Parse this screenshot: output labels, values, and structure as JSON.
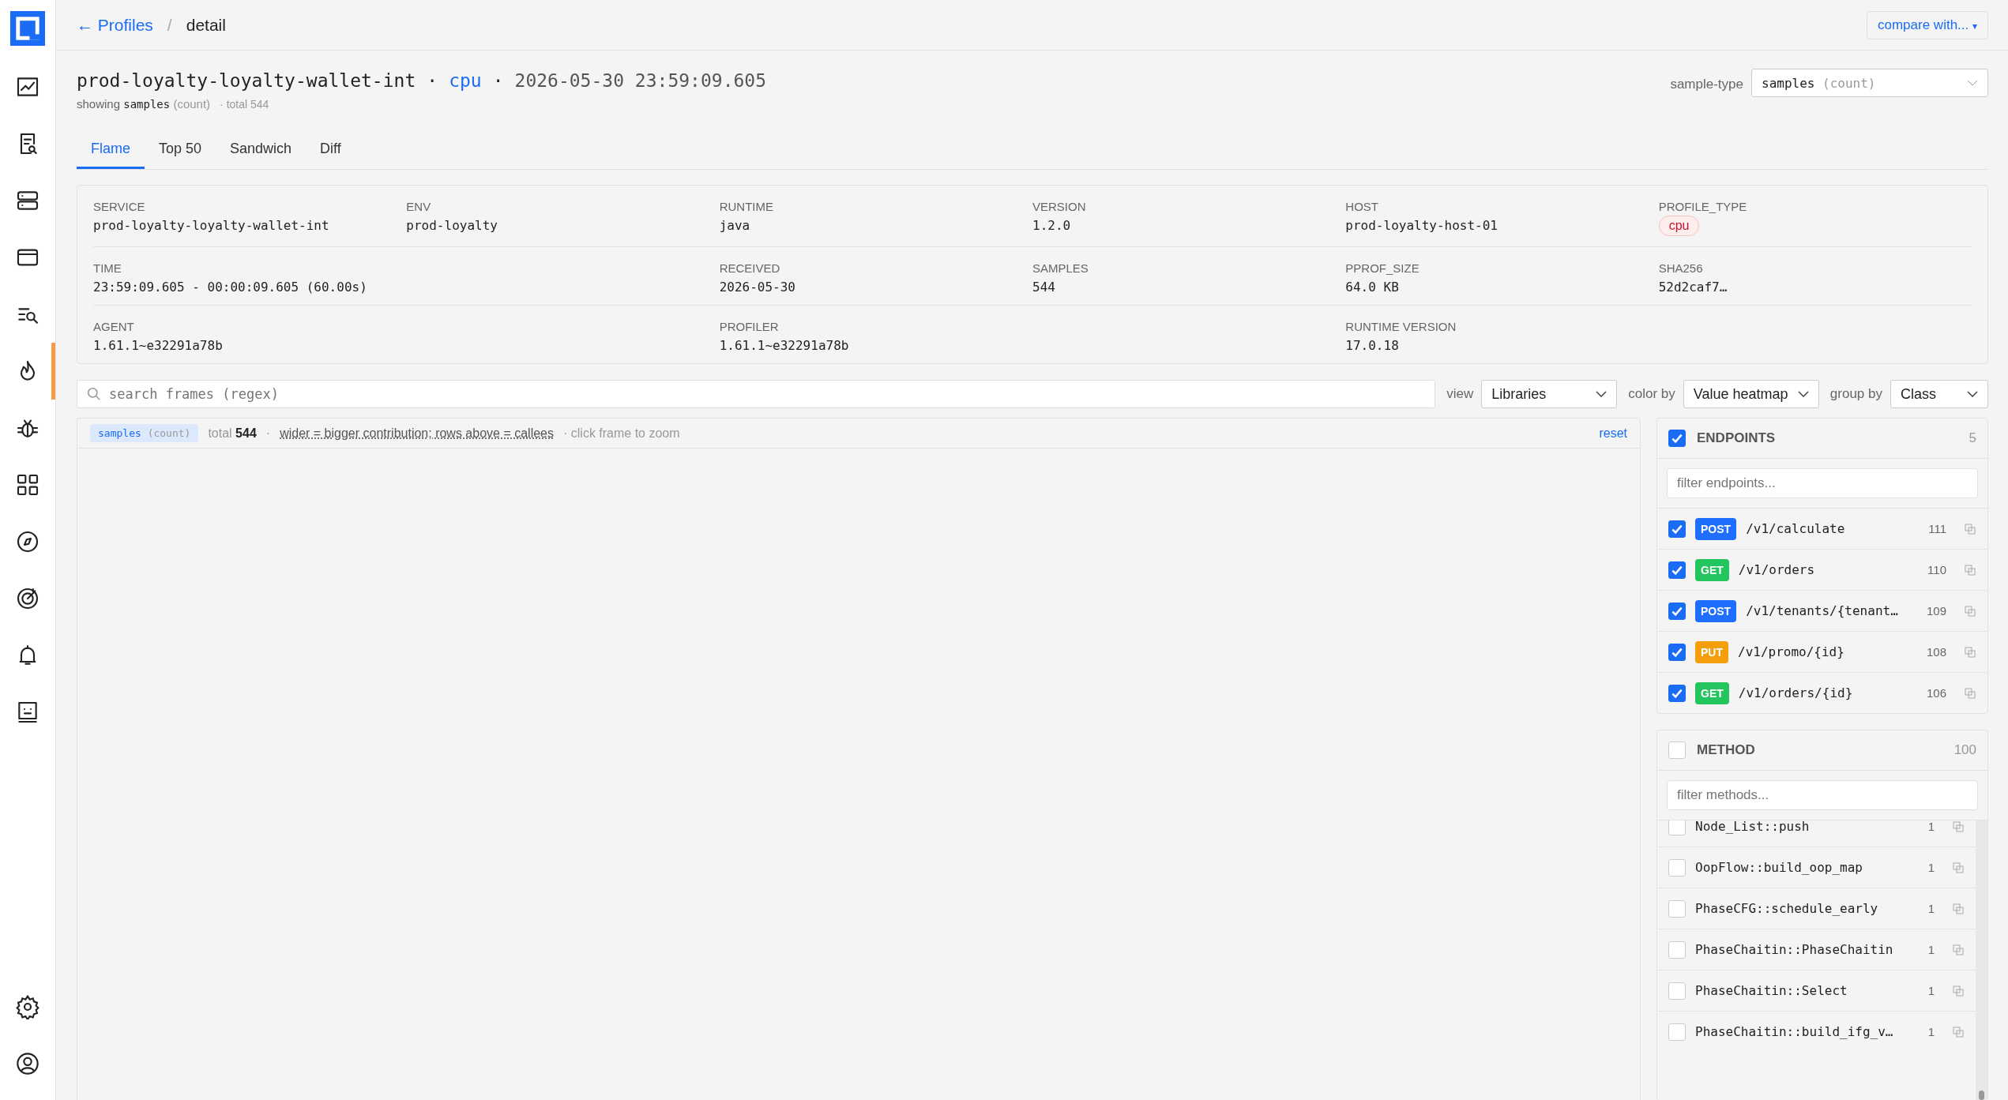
{
  "sidebar": {
    "items": [
      {
        "selected": false
      },
      {
        "selected": false
      },
      {
        "selected": false
      },
      {
        "selected": false
      },
      {
        "selected": false
      },
      {
        "selected": true
      },
      {
        "selected": false
      },
      {
        "selected": false
      },
      {
        "selected": false
      },
      {
        "selected": false
      },
      {
        "selected": false
      },
      {
        "selected": false
      }
    ],
    "bottom_items": [
      {
        "selected": false
      },
      {
        "selected": false
      }
    ]
  },
  "breadcrumb": {
    "back": "← Profiles",
    "separator": "/",
    "current": "detail"
  },
  "compare_button": {
    "label": "compare with...",
    "caret": "▾"
  },
  "title": {
    "service": "prod-loyalty-loyalty-wallet-int",
    "sep1": "·",
    "type": "cpu",
    "sep2": "·",
    "timestamp": "2026-05-30 23:59:09.605"
  },
  "subtitle": {
    "prefix": "showing",
    "metric": "samples",
    "unit": "(count)",
    "total": "· total 544"
  },
  "sample_type": {
    "label": "sample-type",
    "value": "samples",
    "unit": "(count)"
  },
  "tabs": [
    {
      "label": "Flame",
      "selected": true
    },
    {
      "label": "Top 50",
      "selected": false
    },
    {
      "label": "Sandwich",
      "selected": false
    },
    {
      "label": "Diff",
      "selected": false
    }
  ],
  "metadata": [
    [
      {
        "label": "SERVICE",
        "value": "prod-loyalty-loyalty-wallet-int",
        "kind": "text"
      },
      {
        "label": "ENV",
        "value": "prod-loyalty",
        "kind": "text"
      },
      {
        "label": "RUNTIME",
        "value": "java",
        "kind": "text"
      },
      {
        "label": "VERSION",
        "value": "1.2.0",
        "kind": "text"
      },
      {
        "label": "HOST",
        "value": "prod-loyalty-host-01",
        "kind": "text"
      },
      {
        "label": "PROFILE_TYPE",
        "value": "cpu",
        "kind": "badge"
      }
    ],
    [
      {
        "label": "TIME",
        "value": "23:59:09.605 - 00:00:09.605 (60.00s)",
        "kind": "text"
      },
      {
        "label": "RECEIVED",
        "value": "2026-05-30",
        "kind": "text"
      },
      {
        "label": "SAMPLES",
        "value": "544",
        "kind": "text"
      },
      {
        "label": "PPROF_SIZE",
        "value": "64.0 KB",
        "kind": "text"
      },
      {
        "label": "SHA256",
        "value": "52d2caf7…",
        "kind": "text"
      }
    ],
    [
      {
        "label": "AGENT",
        "value": "1.61.1~e32291a78b",
        "kind": "text"
      },
      {
        "label": "PROFILER",
        "value": "1.61.1~e32291a78b",
        "kind": "text"
      },
      {
        "label": "RUNTIME VERSION",
        "value": "17.0.18",
        "kind": "text"
      }
    ]
  ],
  "search": {
    "placeholder": "search frames (regex)"
  },
  "view": {
    "label": "view",
    "value": "Libraries"
  },
  "color_by": {
    "label": "color by",
    "value": "Value heatmap"
  },
  "group_by": {
    "label": "group by",
    "value": "Class"
  },
  "flame": {
    "metric": "samples",
    "unit": "(count)",
    "total_label": "total",
    "total": "544",
    "dot": "·",
    "hint": "wider = bigger contribution; rows above = callees",
    "click_hint": "· click frame to zoom",
    "reset": "reset"
  },
  "endpoints": {
    "title": "ENDPOINTS",
    "checked": true,
    "count": "5",
    "placeholder": "filter endpoints...",
    "items": [
      {
        "checked": true,
        "method": "POST",
        "color": "#1f6fff",
        "path": "/v1/calculate",
        "count": "111"
      },
      {
        "checked": true,
        "method": "GET",
        "color": "#22c55e",
        "path": "/v1/orders",
        "count": "110"
      },
      {
        "checked": true,
        "method": "POST",
        "color": "#1f6fff",
        "path": "/v1/tenants/{tenant…",
        "count": "109"
      },
      {
        "checked": true,
        "method": "PUT",
        "color": "#f59e0b",
        "path": "/v1/promo/{id}",
        "count": "108"
      },
      {
        "checked": true,
        "method": "GET",
        "color": "#22c55e",
        "path": "/v1/orders/{id}",
        "count": "106"
      }
    ]
  },
  "methods": {
    "title": "METHOD",
    "checked": false,
    "count": "100",
    "placeholder": "filter methods...",
    "items": [
      {
        "checked": false,
        "name": "Node_List::push",
        "count": "1"
      },
      {
        "checked": false,
        "name": "OopFlow::build_oop_map",
        "count": "1"
      },
      {
        "checked": false,
        "name": "PhaseCFG::schedule_early",
        "count": "1"
      },
      {
        "checked": false,
        "name": "PhaseChaitin::PhaseChaitin",
        "count": "1"
      },
      {
        "checked": false,
        "name": "PhaseChaitin::Select",
        "count": "1"
      },
      {
        "checked": false,
        "name": "PhaseChaitin::build_ifg_v…",
        "count": "1"
      }
    ]
  }
}
